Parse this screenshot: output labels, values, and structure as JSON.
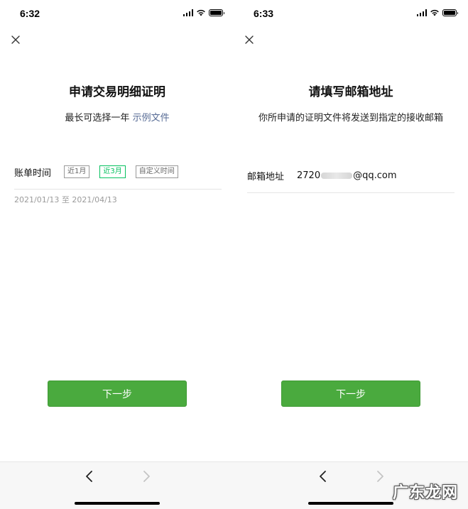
{
  "left_screen": {
    "status_time": "6:32",
    "title": "申请交易明细证明",
    "subtitle_text": "最长可选择一年",
    "subtitle_link": "示例文件",
    "bill_label": "账单时间",
    "chips": [
      {
        "label": "近1月",
        "selected": false
      },
      {
        "label": "近3月",
        "selected": true
      },
      {
        "label": "自定义时间",
        "selected": false
      }
    ],
    "date_range": "2021/01/13 至 2021/04/13",
    "next_button": "下一步"
  },
  "right_screen": {
    "status_time": "6:33",
    "title": "请填写邮箱地址",
    "subtitle": "你所申请的证明文件将发送到指定的接收邮箱",
    "email_label": "邮箱地址",
    "email_prefix": "2720",
    "email_suffix": "@qq.com",
    "next_button": "下一步"
  },
  "watermark": "广东龙网",
  "icons": {
    "close": "close-icon",
    "back": "chevron-left-icon",
    "forward": "chevron-right-icon",
    "signal": "signal-icon",
    "wifi": "wifi-icon",
    "battery": "battery-icon"
  },
  "colors": {
    "accent_green": "#4aaa3e",
    "chip_selected": "#07c160",
    "link_blue": "#576b95"
  }
}
